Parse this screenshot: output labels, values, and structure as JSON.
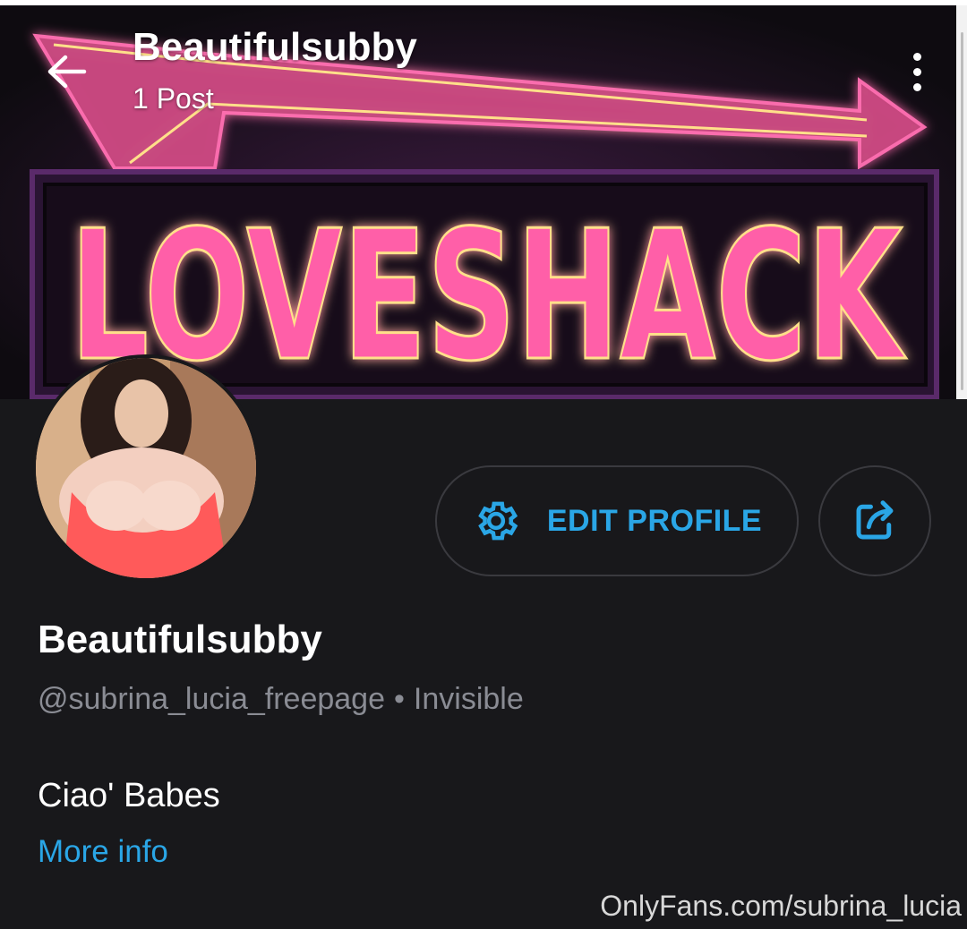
{
  "header": {
    "title": "Beautifulsubby",
    "post_count": "1 Post"
  },
  "cover": {
    "sign_text": "LOVESHACK",
    "neon_pink": "#ff5fa8",
    "neon_yellow": "#ffe08a"
  },
  "icons": {
    "back": "arrow-left-icon",
    "more": "vertical-dots-icon",
    "settings": "gear-icon",
    "share": "share-icon"
  },
  "profile": {
    "edit_label": "EDIT PROFILE",
    "name": "Beautifulsubby",
    "handle": "@subrina_lucia_freepage",
    "separator": "•",
    "status": "Invisible",
    "bio": "Ciao' Babes",
    "more_info_label": "More info"
  },
  "watermark": "OnlyFans.com/subrina_lucia",
  "colors": {
    "background": "#18181b",
    "accent": "#2aa6e6",
    "muted_text": "#8a8c94"
  }
}
